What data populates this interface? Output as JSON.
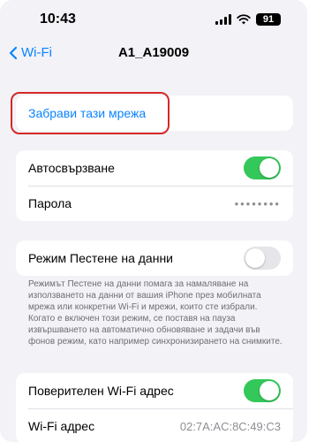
{
  "status_bar": {
    "time": "10:43",
    "battery": "91"
  },
  "nav": {
    "back_label": "Wi-Fi",
    "title": "A1_A19009"
  },
  "forget": {
    "label": "Забрави тази мрежа"
  },
  "auto_join": {
    "label": "Автосвързване",
    "on": true
  },
  "password": {
    "label": "Парола",
    "value": "••••••••"
  },
  "low_data": {
    "label": "Режим Пестене на данни",
    "on": false,
    "footnote": "Режимът Пестене на данни помага за намаляване на използването на данни от вашия iPhone през мобилната мрежа или конкретни Wi-Fi и мрежи, които сте избрали. Когато е включен този режим, се поставя на пауза извършването на автоматично обновяване и задачи във фонов режим, като например синхронизирането на снимките."
  },
  "private_address": {
    "label": "Поверителен Wi-Fi адрес",
    "on": true
  },
  "wifi_address": {
    "label": "Wi-Fi адрес",
    "value": "02:7A:AC:8C:49:C3"
  },
  "colors": {
    "accent": "#0a84ff",
    "toggle_on": "#34c759",
    "highlight": "#d62828"
  }
}
